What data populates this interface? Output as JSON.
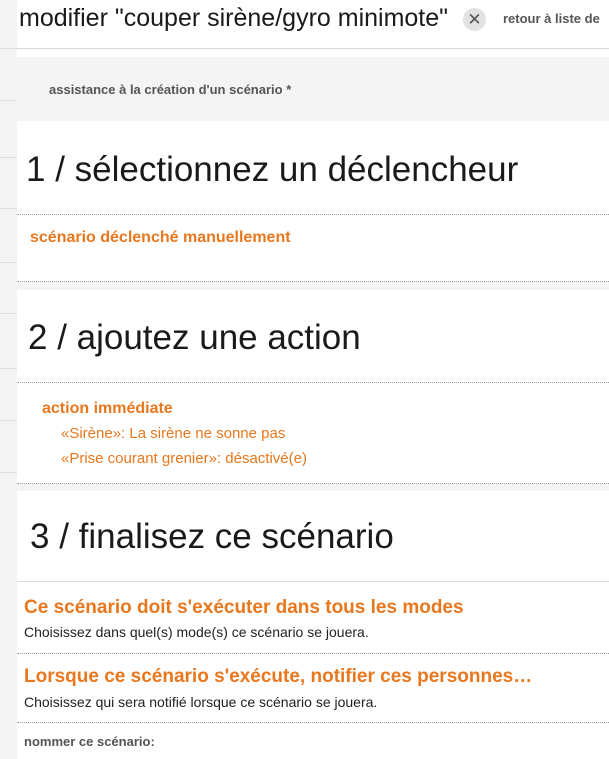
{
  "header": {
    "title": "modifier \"couper sirène/gyro minimote\"",
    "close_glyph": "✕",
    "back_link": "retour à liste de"
  },
  "assist": {
    "text": "assistance à la création d'un scénario *"
  },
  "step1": {
    "title": "1 / sélectionnez un déclencheur",
    "trigger": "scénario déclenché manuellement"
  },
  "step2": {
    "title": "2 / ajoutez une action",
    "action_type": "action immédiate",
    "actions": [
      "«Sirène»: La sirène ne sonne pas",
      "«Prise courant grenier»: désactivé(e)"
    ]
  },
  "step3": {
    "title": "3 / finalisez ce scénario",
    "modes_title": "Ce scénario doit s'exécuter  dans tous les modes",
    "modes_desc": "Choisissez dans quel(s) mode(s) ce scénario se jouera.",
    "notify_title": "Lorsque ce scénario s'exécute,  notifier ces personnes…",
    "notify_desc": "Choisissez qui sera notifié lorsque ce scénario se jouera.",
    "name_label": "nommer ce scénario:"
  },
  "colors": {
    "accent_orange": "#e8771d",
    "text_dark": "#1a1a1a",
    "band_gray": "#f4f4f4"
  },
  "icons": {
    "close": "close-icon"
  }
}
